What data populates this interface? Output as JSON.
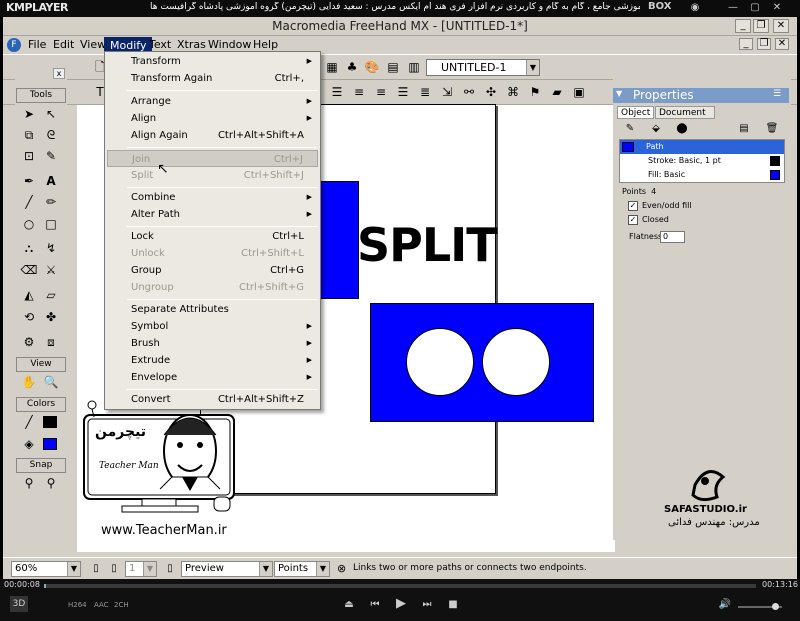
{
  "player": {
    "logo": "KMPLAYER",
    "title": "مجموعه آموزشی جامع ، گام به گام و کاربردی نرم افزار فری هند ام ایکس   مدرس : سعید فدایی (تیچرمن) گروه آموزشی پادشاه گرافیست ها",
    "box_label": "BOX",
    "time_current": "00:00:08",
    "time_total": "00:13:16",
    "quality_buttons": [
      "H264",
      "AAC",
      "2CH"
    ]
  },
  "app": {
    "title": "Macromedia FreeHand MX - [UNTITLED-1*]",
    "menus": [
      "File",
      "Edit",
      "View",
      "Modify",
      "Text",
      "Xtras",
      "Window",
      "Help"
    ],
    "active_menu": "Modify",
    "page_select": "UNTITLED-1"
  },
  "modify_menu": {
    "items": [
      {
        "label": "Transform",
        "shortcut": "",
        "submenu": true,
        "enabled": true
      },
      {
        "label": "Transform Again",
        "shortcut": "Ctrl+,",
        "submenu": false,
        "enabled": true
      },
      {
        "label": "Arrange",
        "shortcut": "",
        "submenu": true,
        "enabled": true
      },
      {
        "label": "Align",
        "shortcut": "",
        "submenu": true,
        "enabled": true
      },
      {
        "label": "Align Again",
        "shortcut": "Ctrl+Alt+Shift+A",
        "submenu": false,
        "enabled": true
      },
      {
        "label": "Join",
        "shortcut": "Ctrl+J",
        "submenu": false,
        "enabled": false,
        "highlighted": true
      },
      {
        "label": "Split",
        "shortcut": "Ctrl+Shift+J",
        "submenu": false,
        "enabled": false
      },
      {
        "label": "Combine",
        "shortcut": "",
        "submenu": true,
        "enabled": true
      },
      {
        "label": "Alter Path",
        "shortcut": "",
        "submenu": true,
        "enabled": true
      },
      {
        "label": "Lock",
        "shortcut": "Ctrl+L",
        "submenu": false,
        "enabled": true
      },
      {
        "label": "Unlock",
        "shortcut": "Ctrl+Shift+L",
        "submenu": false,
        "enabled": false
      },
      {
        "label": "Group",
        "shortcut": "Ctrl+G",
        "submenu": false,
        "enabled": true
      },
      {
        "label": "Ungroup",
        "shortcut": "Ctrl+Shift+G",
        "submenu": false,
        "enabled": false
      },
      {
        "label": "Separate Attributes",
        "shortcut": "",
        "submenu": false,
        "enabled": true
      },
      {
        "label": "Symbol",
        "shortcut": "",
        "submenu": true,
        "enabled": true
      },
      {
        "label": "Brush",
        "shortcut": "",
        "submenu": true,
        "enabled": true
      },
      {
        "label": "Extrude",
        "shortcut": "",
        "submenu": true,
        "enabled": true
      },
      {
        "label": "Envelope",
        "shortcut": "",
        "submenu": true,
        "enabled": true
      },
      {
        "label": "Convert",
        "shortcut": "Ctrl+Alt+Shift+Z",
        "submenu": false,
        "enabled": true
      }
    ]
  },
  "toolbox": {
    "sections": [
      "Tools",
      "View",
      "Colors",
      "Snap"
    ]
  },
  "canvas": {
    "split_text": "SPLIT",
    "fill_color": "#0000ff"
  },
  "properties": {
    "title": "Properties",
    "tabs": [
      "Object",
      "Document"
    ],
    "rows": [
      "Path",
      "Stroke: Basic, 1 pt",
      "Fill: Basic"
    ],
    "points_label": "Points",
    "points_value": "4",
    "evenodd_label": "Even/odd fill",
    "closed_label": "Closed",
    "flatness_label": "Flatness:",
    "flatness_value": "0"
  },
  "status": {
    "zoom": "60%",
    "page_num": "1",
    "mode": "Preview",
    "units": "Points",
    "hint": "Links two or more paths or connects two endpoints."
  },
  "watermark": {
    "teacher_logo_text": "تیچرمن",
    "teacher_name": "Teacher Man",
    "url": "www.TeacherMan.ir",
    "studio": "SAFASTUDIO.ir",
    "studio_sub": "مدرس: مهندس فدائی"
  }
}
